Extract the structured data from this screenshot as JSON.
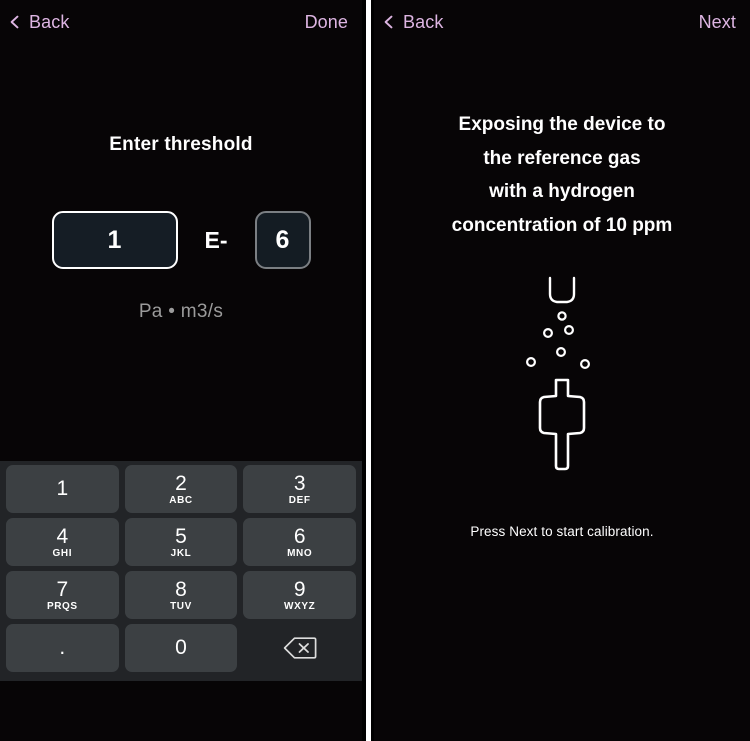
{
  "left_screen": {
    "nav": {
      "back_label": "Back",
      "back_icon": "chevron-left-icon",
      "action_label": "Done"
    },
    "title": "Enter threshold",
    "input": {
      "mantissa_value": "1",
      "exponent_prefix": "E-",
      "exponent_value": "6",
      "unit_label": "Pa • m3/s"
    },
    "keypad": {
      "keys": [
        {
          "digit": "1",
          "letters": ""
        },
        {
          "digit": "2",
          "letters": "ABC"
        },
        {
          "digit": "3",
          "letters": "DEF"
        },
        {
          "digit": "4",
          "letters": "GHI"
        },
        {
          "digit": "5",
          "letters": "JKL"
        },
        {
          "digit": "6",
          "letters": "MNO"
        },
        {
          "digit": "7",
          "letters": "PRQS"
        },
        {
          "digit": "8",
          "letters": "TUV"
        },
        {
          "digit": "9",
          "letters": "WXYZ"
        },
        {
          "digit": ".",
          "letters": ""
        },
        {
          "digit": "0",
          "letters": ""
        }
      ],
      "backspace_icon": "backspace-icon"
    }
  },
  "right_screen": {
    "nav": {
      "back_label": "Back",
      "back_icon": "chevron-left-icon",
      "action_label": "Next"
    },
    "instruction_lines": [
      "Exposing the device to",
      "the reference gas",
      "with a hydrogen",
      "concentration of 10 ppm"
    ],
    "illustration_name": "gas-nozzle-and-sniffer-probe-illustration",
    "footer_text": "Press Next to start calibration."
  },
  "colors": {
    "accent": "#ddb5e2",
    "background": "#070506",
    "key_face": "#3c4043",
    "keypad_bg": "#222427",
    "input_fill": "#151d25",
    "focus_border": "#ffffff",
    "idle_border": "#7b7f83",
    "muted_text": "#9b9b9b"
  }
}
